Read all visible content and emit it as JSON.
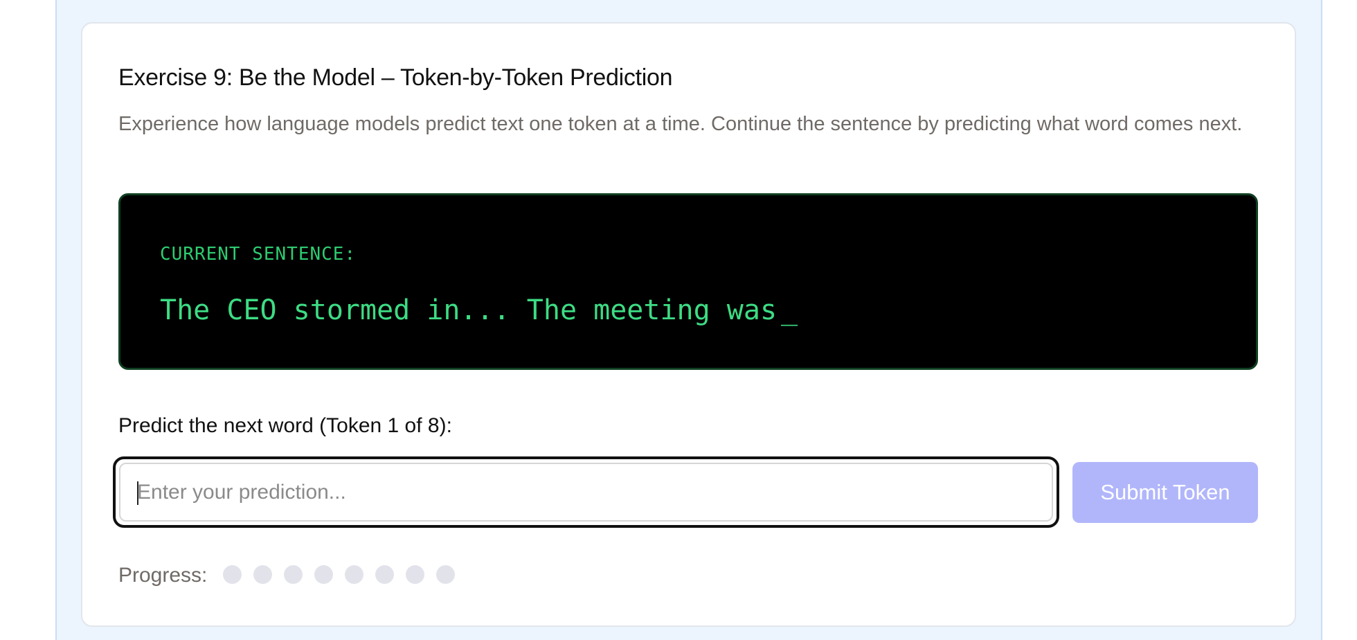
{
  "exercise": {
    "title": "Exercise 9: Be the Model – Token-by-Token Prediction",
    "description": "Experience how language models predict text one token at a time. Continue the sentence by predicting what word comes next."
  },
  "terminal": {
    "label": "CURRENT SENTENCE:",
    "sentence": "The CEO stormed in... The meeting was",
    "cursor": "_"
  },
  "prediction": {
    "label": "Predict the next word (Token 1 of 8):",
    "current_token": 1,
    "total_tokens": 8,
    "input_value": "",
    "input_placeholder": "Enter your prediction...",
    "submit_label": "Submit Token"
  },
  "progress": {
    "label": "Progress:",
    "completed": 0,
    "total": 8
  },
  "colors": {
    "accent": "#b1b6fb",
    "terminal_text": "#3ddc84",
    "terminal_bg": "#000000",
    "dot_empty": "#e2e3ea"
  }
}
